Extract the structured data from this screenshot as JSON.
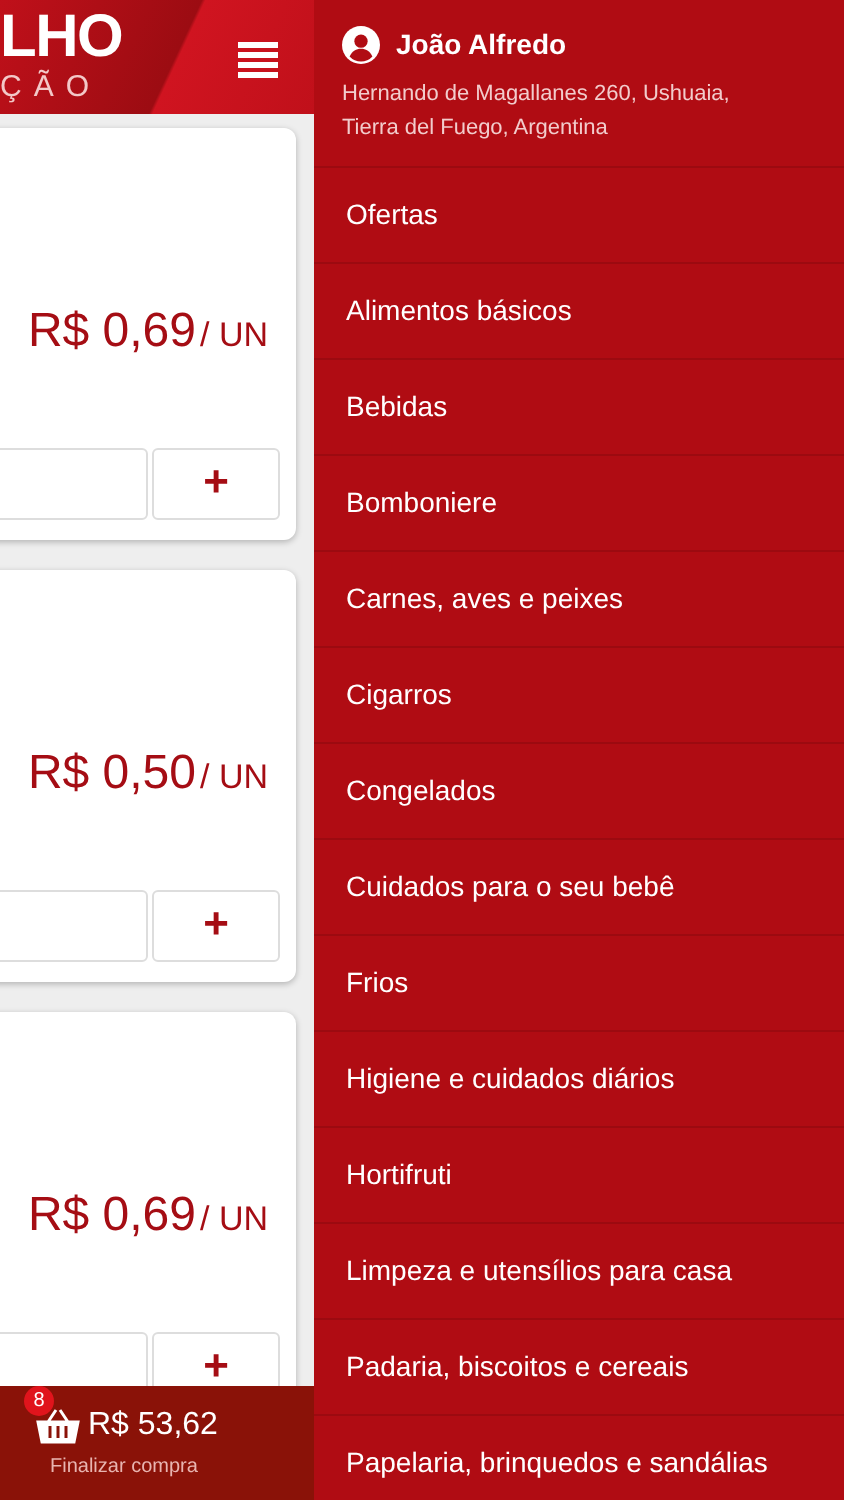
{
  "header": {
    "logo_line_1": "LHO",
    "logo_line_2": "ÇÃO"
  },
  "products": [
    {
      "price": "R$ 0,69",
      "unit": "/ UN",
      "add": "+"
    },
    {
      "price": "R$ 0,50",
      "unit": "/ UN",
      "add": "+"
    },
    {
      "price": "R$ 0,69",
      "unit": "/ UN",
      "add": "+"
    }
  ],
  "cart": {
    "count": "8",
    "total": "R$ 53,62",
    "action": "Finalizar compra"
  },
  "drawer": {
    "user_name": "João Alfredo",
    "address": "Hernando de Magallanes 260, Ushuaia, Tierra del Fuego, Argentina",
    "items": [
      "Ofertas",
      "Alimentos básicos",
      "Bebidas",
      "Bomboniere",
      "Carnes, aves e peixes",
      "Cigarros",
      "Congelados",
      "Cuidados para o seu bebê",
      "Frios",
      "Higiene e cuidados diários",
      "Hortifruti",
      "Limpeza e utensílios para casa",
      "Padaria, biscoitos e cereais",
      "Papelaria, brinquedos e sandálias"
    ]
  }
}
